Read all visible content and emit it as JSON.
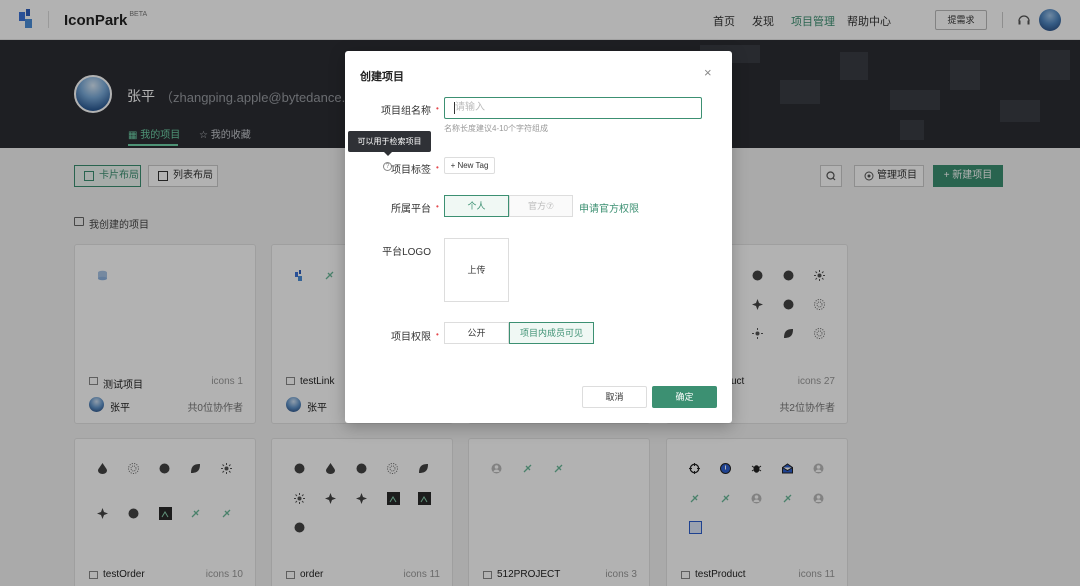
{
  "header": {
    "brand": "IconPark",
    "beta": "BETA",
    "nav": [
      "首页",
      "发现",
      "项目管理",
      "帮助中心"
    ],
    "nav_active_index": 2,
    "request_button": "提需求"
  },
  "profile": {
    "name": "张平",
    "email": "（zhangping.apple@bytedance.com）",
    "tabs": [
      "我的项目",
      "我的收藏"
    ]
  },
  "toolbar": {
    "card_layout": "卡片布局",
    "list_layout": "列表布局",
    "manage": "管理项目",
    "new_project": "+ 新建项目"
  },
  "section_title": "我创建的项目",
  "cards": [
    {
      "name": "测试项目",
      "count": "icons 1",
      "owner": "张平",
      "collab": "共0位协作者"
    },
    {
      "name": "testLink",
      "count": "",
      "owner": "张平",
      "collab": ""
    },
    {
      "name": "uct",
      "count": "icons 27",
      "owner": "",
      "collab": "共2位协作者"
    },
    {
      "name": "testOrder",
      "count": "icons 10"
    },
    {
      "name": "order",
      "count": "icons 11"
    },
    {
      "name": "512PROJECT",
      "count": "icons 3"
    },
    {
      "name": "testProduct",
      "count": "icons 11"
    }
  ],
  "modal": {
    "title": "创建项目",
    "close": "×",
    "name_label": "项目组名称",
    "name_placeholder": "请输入",
    "name_hint": "名称长度建议4-10个字符组成",
    "tooltip": "可以用于检索项目",
    "tag_label": "项目标签",
    "new_tag": "+ New Tag",
    "platform_label": "所属平台",
    "platform_personal": "个人",
    "platform_official": "官方⑦",
    "apply_link": "申请官方权限",
    "logo_label": "平台LOGO",
    "upload": "上传",
    "perm_label": "项目权限",
    "perm_public": "公开",
    "perm_members": "项目内成员可见",
    "cancel": "取消",
    "confirm": "确定"
  },
  "colors": {
    "accent": "#3c9072",
    "banner": "#2b2d33"
  }
}
